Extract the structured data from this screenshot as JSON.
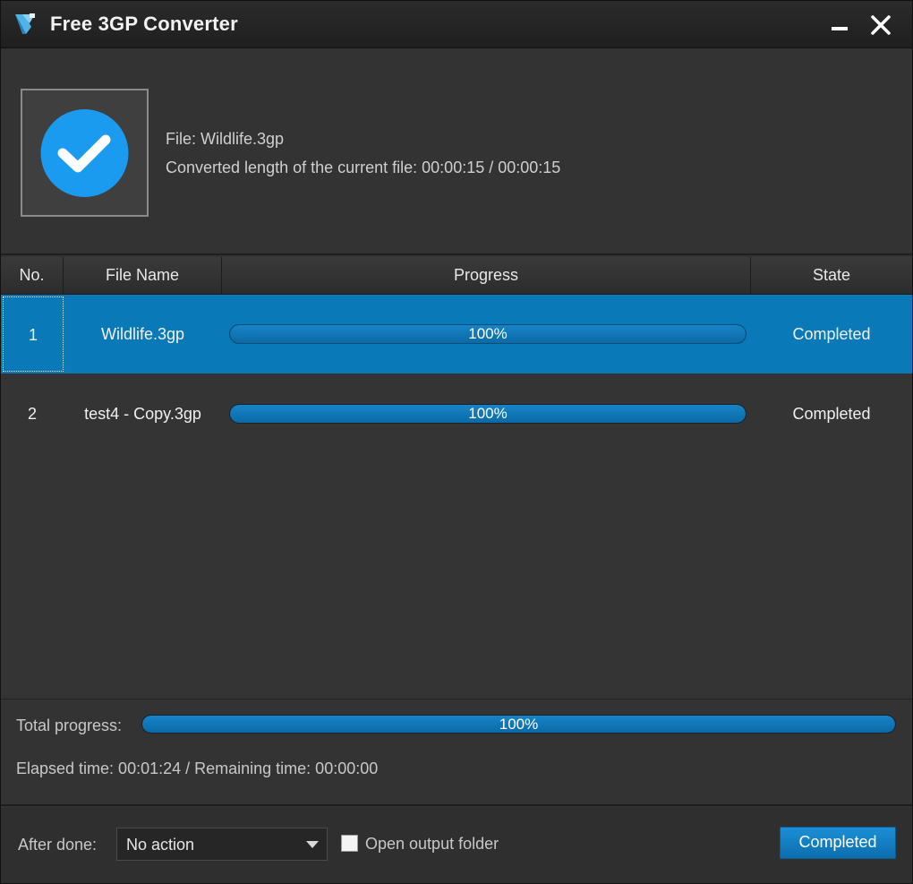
{
  "window": {
    "title": "Free 3GP Converter"
  },
  "info": {
    "file_line": "File: Wildlife.3gp",
    "length_line": "Converted length of the current file: 00:00:15 / 00:00:15"
  },
  "table": {
    "columns": [
      "No.",
      "File Name",
      "Progress",
      "State"
    ],
    "rows": [
      {
        "no": "1",
        "name": "Wildlife.3gp",
        "progress": 1.0,
        "progress_label": "100%",
        "state": "Completed",
        "selected": true
      },
      {
        "no": "2",
        "name": "test4 - Copy.3gp",
        "progress": 1.0,
        "progress_label": "100%",
        "state": "Completed",
        "selected": false
      }
    ]
  },
  "total": {
    "label": "Total progress:",
    "progress": 1.0,
    "progress_label": "100%",
    "elapsed": "Elapsed time: 00:01:24 / Remaining time: 00:00:00"
  },
  "footer": {
    "after_label": "After done:",
    "after_value": "No action",
    "open_folder_label": "Open output folder",
    "open_folder_checked": false,
    "button_label": "Completed"
  },
  "colors": {
    "accent": "#0a79b8",
    "check_circle": "#1b9bf0",
    "background": "#333333"
  },
  "icons": {
    "app": "app-logo-icon",
    "status": "checkmark-circle-icon",
    "minimize": "minimize-icon",
    "close": "close-icon",
    "dropdown": "chevron-down-icon"
  }
}
